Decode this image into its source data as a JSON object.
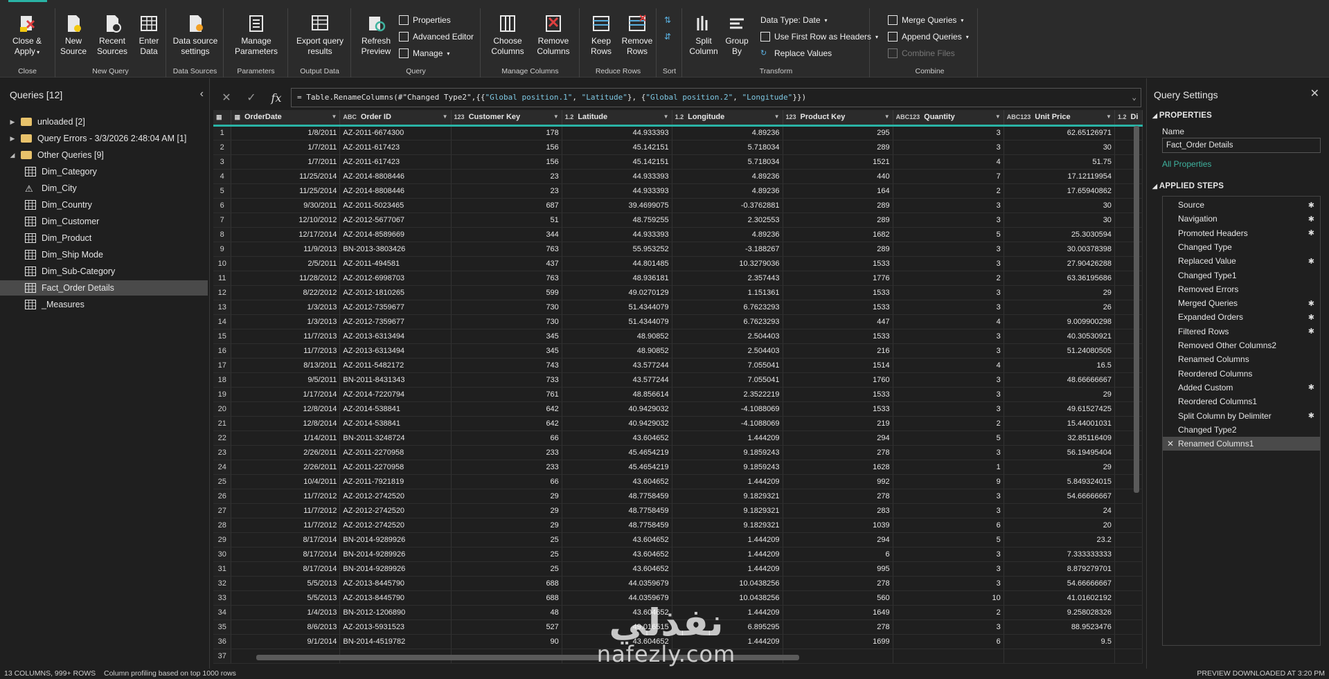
{
  "ribbon": {
    "groups": {
      "close": {
        "label": "Close",
        "btn_close_apply": "Close & Apply"
      },
      "new_query": {
        "label": "New Query",
        "btn_new_source": "New Source",
        "btn_recent_sources": "Recent Sources",
        "btn_enter_data": "Enter Data"
      },
      "data_sources": {
        "label": "Data Sources",
        "btn_settings": "Data source settings"
      },
      "parameters": {
        "label": "Parameters",
        "btn_manage_params": "Manage Parameters"
      },
      "output_data": {
        "label": "Output Data",
        "btn_export": "Export query results"
      },
      "query": {
        "label": "Query",
        "btn_refresh": "Refresh Preview",
        "btn_properties": "Properties",
        "btn_advanced": "Advanced Editor",
        "btn_manage": "Manage"
      },
      "manage_columns": {
        "label": "Manage Columns",
        "btn_choose": "Choose Columns",
        "btn_remove": "Remove Columns"
      },
      "reduce_rows": {
        "label": "Reduce Rows",
        "btn_keep": "Keep Rows",
        "btn_remove": "Remove Rows"
      },
      "sort": {
        "label": "Sort"
      },
      "transform": {
        "label": "Transform",
        "btn_split": "Split Column",
        "btn_group": "Group By",
        "btn_datatype": "Data Type: Date",
        "btn_first_row": "Use First Row as Headers",
        "btn_replace": "Replace Values"
      },
      "combine": {
        "label": "Combine",
        "btn_merge": "Merge Queries",
        "btn_append": "Append Queries",
        "btn_combine_files": "Combine Files"
      }
    }
  },
  "queries": {
    "title": "Queries [12]",
    "items": [
      {
        "label": "unloaded [2]",
        "kind": "folder",
        "indent": 0,
        "arrow": "▶"
      },
      {
        "label": "Query Errors - 3/3/2026 2:48:04 AM [1]",
        "kind": "folder",
        "indent": 0,
        "arrow": "▶"
      },
      {
        "label": "Other Queries [9]",
        "kind": "folder",
        "indent": 0,
        "arrow": "◢"
      },
      {
        "label": "Dim_Category",
        "kind": "table",
        "indent": 1
      },
      {
        "label": "Dim_City",
        "kind": "warning",
        "indent": 1
      },
      {
        "label": "Dim_Country",
        "kind": "table",
        "indent": 1
      },
      {
        "label": "Dim_Customer",
        "kind": "table",
        "indent": 1
      },
      {
        "label": "Dim_Product",
        "kind": "table",
        "indent": 1
      },
      {
        "label": "Dim_Ship Mode",
        "kind": "table",
        "indent": 1
      },
      {
        "label": "Dim_Sub-Category",
        "kind": "table",
        "indent": 1
      },
      {
        "label": "Fact_Order Details",
        "kind": "table",
        "indent": 1,
        "selected": true
      },
      {
        "label": "_Measures",
        "kind": "table",
        "indent": 1
      }
    ]
  },
  "formula": {
    "prefix": "= Table.RenameColumns(#\"Changed Type2\",{{",
    "s1": "\"Global position.1\"",
    "sep1": ", ",
    "s2": "\"Latitude\"",
    "sep2": "}, {",
    "s3": "\"Global position.2\"",
    "sep3": ", ",
    "s4": "\"Longitude\"",
    "suffix": "}})"
  },
  "grid": {
    "columns": [
      {
        "type": "▦",
        "name": ""
      },
      {
        "type": "▦",
        "name": "OrderDate"
      },
      {
        "type": "ABC",
        "name": "Order ID"
      },
      {
        "type": "123",
        "name": "Customer Key"
      },
      {
        "type": "1.2",
        "name": "Latitude"
      },
      {
        "type": "1.2",
        "name": "Longitude"
      },
      {
        "type": "123",
        "name": "Product Key"
      },
      {
        "type": "ABC123",
        "name": "Quantity"
      },
      {
        "type": "ABC123",
        "name": "Unit Price"
      },
      {
        "type": "1.2",
        "name": "Di"
      }
    ],
    "rows": [
      [
        "1",
        "1/8/2011",
        "AZ-2011-6674300",
        "178",
        "44.933393",
        "4.89236",
        "295",
        "3",
        "62.65126971",
        ""
      ],
      [
        "2",
        "1/7/2011",
        "AZ-2011-617423",
        "156",
        "45.142151",
        "5.718034",
        "289",
        "3",
        "30",
        ""
      ],
      [
        "3",
        "1/7/2011",
        "AZ-2011-617423",
        "156",
        "45.142151",
        "5.718034",
        "1521",
        "4",
        "51.75",
        ""
      ],
      [
        "4",
        "11/25/2014",
        "AZ-2014-8808446",
        "23",
        "44.933393",
        "4.89236",
        "440",
        "7",
        "17.12119954",
        ""
      ],
      [
        "5",
        "11/25/2014",
        "AZ-2014-8808446",
        "23",
        "44.933393",
        "4.89236",
        "164",
        "2",
        "17.65940862",
        ""
      ],
      [
        "6",
        "9/30/2011",
        "AZ-2011-5023465",
        "687",
        "39.4699075",
        "-0.3762881",
        "289",
        "3",
        "30",
        ""
      ],
      [
        "7",
        "12/10/2012",
        "AZ-2012-5677067",
        "51",
        "48.759255",
        "2.302553",
        "289",
        "3",
        "30",
        ""
      ],
      [
        "8",
        "12/17/2014",
        "AZ-2014-8589669",
        "344",
        "44.933393",
        "4.89236",
        "1682",
        "5",
        "25.3030594",
        ""
      ],
      [
        "9",
        "11/9/2013",
        "BN-2013-3803426",
        "763",
        "55.953252",
        "-3.188267",
        "289",
        "3",
        "30.00378398",
        ""
      ],
      [
        "10",
        "2/5/2011",
        "AZ-2011-494581",
        "437",
        "44.801485",
        "10.3279036",
        "1533",
        "3",
        "27.90426288",
        ""
      ],
      [
        "11",
        "11/28/2012",
        "AZ-2012-6998703",
        "763",
        "48.936181",
        "2.357443",
        "1776",
        "2",
        "63.36195686",
        ""
      ],
      [
        "12",
        "8/22/2012",
        "AZ-2012-1810265",
        "599",
        "49.0270129",
        "1.151361",
        "1533",
        "3",
        "29",
        ""
      ],
      [
        "13",
        "1/3/2013",
        "AZ-2012-7359677",
        "730",
        "51.4344079",
        "6.7623293",
        "1533",
        "3",
        "26",
        ""
      ],
      [
        "14",
        "1/3/2013",
        "AZ-2012-7359677",
        "730",
        "51.4344079",
        "6.7623293",
        "447",
        "4",
        "9.009900298",
        ""
      ],
      [
        "15",
        "11/7/2013",
        "AZ-2013-6313494",
        "345",
        "48.90852",
        "2.504403",
        "1533",
        "3",
        "40.30530921",
        ""
      ],
      [
        "16",
        "11/7/2013",
        "AZ-2013-6313494",
        "345",
        "48.90852",
        "2.504403",
        "216",
        "3",
        "51.24080505",
        ""
      ],
      [
        "17",
        "8/13/2011",
        "AZ-2011-5482172",
        "743",
        "43.577244",
        "7.055041",
        "1514",
        "4",
        "16.5",
        ""
      ],
      [
        "18",
        "9/5/2011",
        "BN-2011-8431343",
        "733",
        "43.577244",
        "7.055041",
        "1760",
        "3",
        "48.66666667",
        ""
      ],
      [
        "19",
        "1/17/2014",
        "AZ-2014-7220794",
        "761",
        "48.856614",
        "2.3522219",
        "1533",
        "3",
        "29",
        ""
      ],
      [
        "20",
        "12/8/2014",
        "AZ-2014-538841",
        "642",
        "40.9429032",
        "-4.1088069",
        "1533",
        "3",
        "49.61527425",
        ""
      ],
      [
        "21",
        "12/8/2014",
        "AZ-2014-538841",
        "642",
        "40.9429032",
        "-4.1088069",
        "219",
        "2",
        "15.44001031",
        ""
      ],
      [
        "22",
        "1/14/2011",
        "BN-2011-3248724",
        "66",
        "43.604652",
        "1.444209",
        "294",
        "5",
        "32.85116409",
        ""
      ],
      [
        "23",
        "2/26/2011",
        "AZ-2011-2270958",
        "233",
        "45.4654219",
        "9.1859243",
        "278",
        "3",
        "56.19495404",
        ""
      ],
      [
        "24",
        "2/26/2011",
        "AZ-2011-2270958",
        "233",
        "45.4654219",
        "9.1859243",
        "1628",
        "1",
        "29",
        ""
      ],
      [
        "25",
        "10/4/2011",
        "AZ-2011-7921819",
        "66",
        "43.604652",
        "1.444209",
        "992",
        "9",
        "5.849324015",
        ""
      ],
      [
        "26",
        "11/7/2012",
        "AZ-2012-2742520",
        "29",
        "48.7758459",
        "9.1829321",
        "278",
        "3",
        "54.66666667",
        ""
      ],
      [
        "27",
        "11/7/2012",
        "AZ-2012-2742520",
        "29",
        "48.7758459",
        "9.1829321",
        "283",
        "3",
        "24",
        ""
      ],
      [
        "28",
        "11/7/2012",
        "AZ-2012-2742520",
        "29",
        "48.7758459",
        "9.1829321",
        "1039",
        "6",
        "20",
        ""
      ],
      [
        "29",
        "8/17/2014",
        "BN-2014-9289926",
        "25",
        "43.604652",
        "1.444209",
        "294",
        "5",
        "23.2",
        ""
      ],
      [
        "30",
        "8/17/2014",
        "BN-2014-9289926",
        "25",
        "43.604652",
        "1.444209",
        "6",
        "3",
        "7.333333333",
        ""
      ],
      [
        "31",
        "8/17/2014",
        "BN-2014-9289926",
        "25",
        "43.604652",
        "1.444209",
        "995",
        "3",
        "8.879279701",
        ""
      ],
      [
        "32",
        "5/5/2013",
        "AZ-2013-8445790",
        "688",
        "44.0359679",
        "10.0438256",
        "278",
        "3",
        "54.66666667",
        ""
      ],
      [
        "33",
        "5/5/2013",
        "AZ-2013-8445790",
        "688",
        "44.0359679",
        "10.0438256",
        "560",
        "10",
        "41.01602192",
        ""
      ],
      [
        "34",
        "1/4/2013",
        "BN-2012-1206890",
        "48",
        "43.604652",
        "1.444209",
        "1649",
        "2",
        "9.258028326",
        ""
      ],
      [
        "35",
        "8/6/2013",
        "AZ-2013-5931523",
        "527",
        "49.016515",
        "6.895295",
        "278",
        "3",
        "88.9523476",
        ""
      ],
      [
        "36",
        "9/1/2014",
        "BN-2014-4519782",
        "90",
        "43.604652",
        "1.444209",
        "1699",
        "6",
        "9.5",
        ""
      ],
      [
        "37",
        "",
        "",
        "",
        "",
        "",
        "",
        "",
        "",
        ""
      ]
    ]
  },
  "settings": {
    "title": "Query Settings",
    "properties_label": "PROPERTIES",
    "name_label": "Name",
    "name_value": "Fact_Order Details",
    "all_properties": "All Properties",
    "applied_steps_label": "APPLIED STEPS",
    "steps": [
      {
        "label": "Source",
        "gear": true
      },
      {
        "label": "Navigation",
        "gear": true
      },
      {
        "label": "Promoted Headers",
        "gear": true
      },
      {
        "label": "Changed Type",
        "gear": false
      },
      {
        "label": "Replaced Value",
        "gear": true
      },
      {
        "label": "Changed Type1",
        "gear": false
      },
      {
        "label": "Removed Errors",
        "gear": false
      },
      {
        "label": "Merged Queries",
        "gear": true
      },
      {
        "label": "Expanded Orders",
        "gear": true
      },
      {
        "label": "Filtered Rows",
        "gear": true
      },
      {
        "label": "Removed Other Columns2",
        "gear": false
      },
      {
        "label": "Renamed Columns",
        "gear": false
      },
      {
        "label": "Reordered Columns",
        "gear": false
      },
      {
        "label": "Added Custom",
        "gear": true
      },
      {
        "label": "Reordered Columns1",
        "gear": false
      },
      {
        "label": "Split Column by Delimiter",
        "gear": true
      },
      {
        "label": "Changed Type2",
        "gear": false
      },
      {
        "label": "Renamed Columns1",
        "gear": false,
        "selected": true
      }
    ]
  },
  "status": {
    "columns_rows": "13 COLUMNS, 999+ ROWS",
    "profiling": "Column profiling based on top 1000 rows",
    "preview": "PREVIEW DOWNLOADED AT 3:20 PM"
  },
  "watermark": {
    "arabic": "نفذلي",
    "latin": "nafezly.com"
  },
  "colors": {
    "accent": "#2ab3a5",
    "background": "#1f1f1f",
    "ribbon": "#2b2b2b",
    "selected": "#4a4a4a",
    "link": "#3fb39f"
  }
}
